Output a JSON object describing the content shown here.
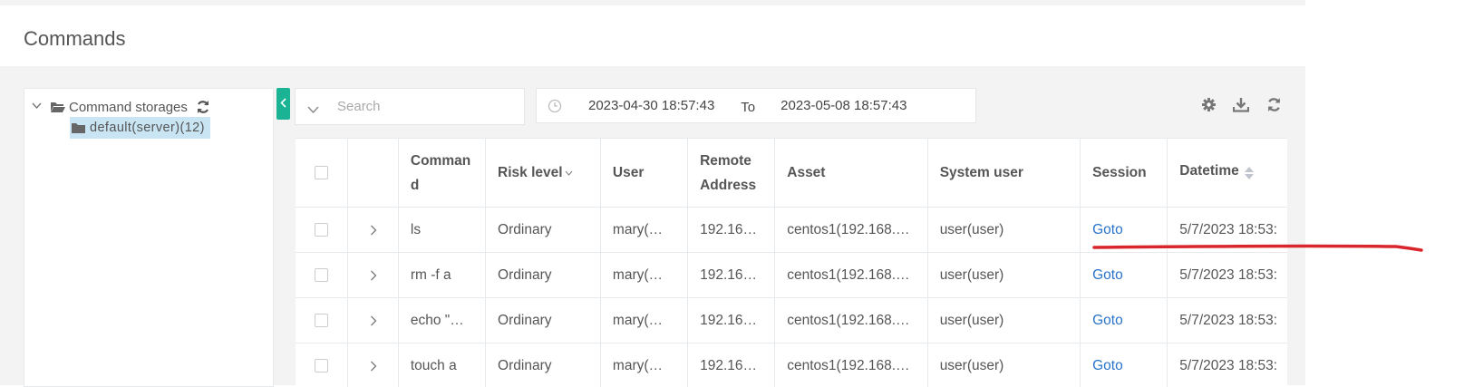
{
  "page": {
    "title": "Commands"
  },
  "tree": {
    "root_label": "Command storages",
    "child_label": "default(server)(12)"
  },
  "search": {
    "placeholder": "Search"
  },
  "date_range": {
    "start": "2023-04-30 18:57:43",
    "separator": "To",
    "end": "2023-05-08 18:57:43"
  },
  "table": {
    "columns": {
      "command_line1": "Comman",
      "command_line2": "d",
      "risk_level": "Risk level",
      "user": "User",
      "remote_line1": "Remote",
      "remote_line2": "Address",
      "asset": "Asset",
      "system_user": "System user",
      "session": "Session",
      "datetime": "Datetime"
    },
    "rows": [
      {
        "command": "ls",
        "risk": "Ordinary",
        "user": "mary(…",
        "remote": "192.16…",
        "asset": "centos1(192.168.…",
        "system_user": "user(user)",
        "session": "Goto",
        "datetime": "5/7/2023 18:53:"
      },
      {
        "command": "rm -f a",
        "risk": "Ordinary",
        "user": "mary(…",
        "remote": "192.16…",
        "asset": "centos1(192.168.…",
        "system_user": "user(user)",
        "session": "Goto",
        "datetime": "5/7/2023 18:53:"
      },
      {
        "command": "echo \"…",
        "risk": "Ordinary",
        "user": "mary(…",
        "remote": "192.16…",
        "asset": "centos1(192.168.…",
        "system_user": "user(user)",
        "session": "Goto",
        "datetime": "5/7/2023 18:53:"
      },
      {
        "command": "touch a",
        "risk": "Ordinary",
        "user": "mary(…",
        "remote": "192.16…",
        "asset": "centos1(192.168.…",
        "system_user": "user(user)",
        "session": "Goto",
        "datetime": "5/7/2023 18:53:"
      }
    ]
  },
  "colors": {
    "accent": "#1ab394",
    "link": "#2a74c9",
    "annotation": "#d9262c",
    "selected_bg": "#c9e4f3"
  },
  "icons": [
    "chevron-down-icon",
    "folder-open-icon",
    "folder-icon",
    "refresh-icon",
    "chevron-left-icon",
    "clock-icon",
    "gear-icon",
    "download-icon",
    "chevron-right-icon",
    "sort-icon"
  ]
}
